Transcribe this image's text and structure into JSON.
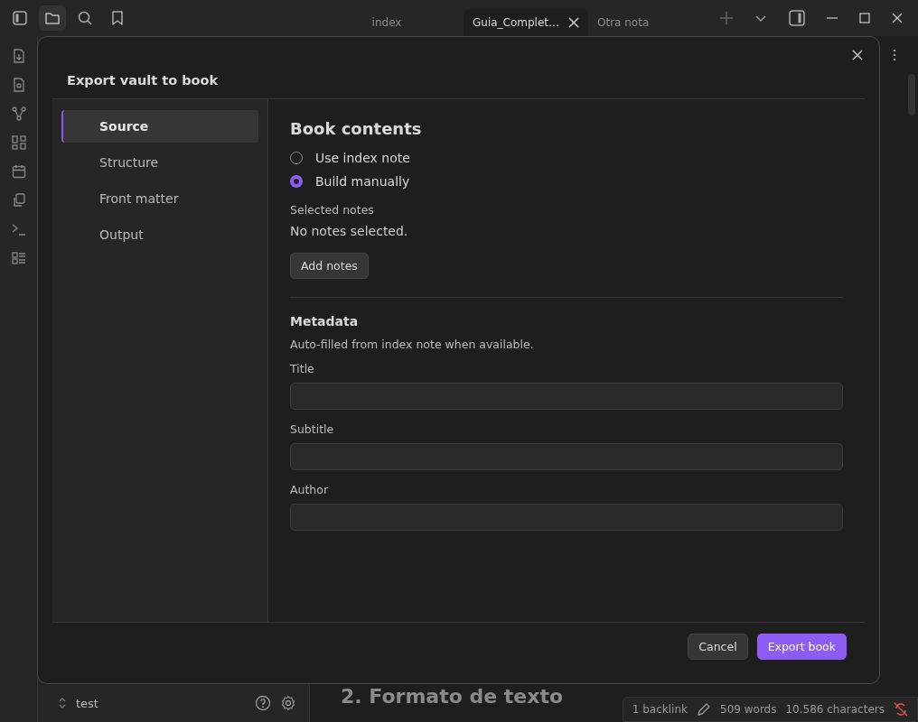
{
  "tabs": [
    {
      "label": "index",
      "selected": false
    },
    {
      "label": "Guia_Complet…",
      "selected": true
    },
    {
      "label": "Otra nota",
      "selected": false
    }
  ],
  "sidebar": {
    "vault": "test"
  },
  "editor": {
    "heading": "2. Formato de texto"
  },
  "status_bar": {
    "backlinks": "1 backlink",
    "words": "509 words",
    "characters": "10.586 characters"
  },
  "modal": {
    "title": "Export vault to book",
    "nav": [
      {
        "label": "Source",
        "selected": true
      },
      {
        "label": "Structure",
        "selected": false
      },
      {
        "label": "Front matter",
        "selected": false
      },
      {
        "label": "Output",
        "selected": false
      }
    ],
    "heading": "Book contents",
    "options": [
      {
        "label": "Use index note",
        "selected": false
      },
      {
        "label": "Build manually",
        "selected": true
      }
    ],
    "selected_label": "Selected notes",
    "selected_value": "No notes selected.",
    "add_button": "Add notes",
    "metadata_heading": "Metadata",
    "metadata_hint": "Auto-filled from index note when available.",
    "fields": [
      {
        "label": "Title"
      },
      {
        "label": "Subtitle"
      },
      {
        "label": "Author"
      }
    ],
    "buttons": [
      {
        "label": "Cancel",
        "kind": "secondary"
      },
      {
        "label": "Export book",
        "kind": "primary"
      }
    ]
  }
}
